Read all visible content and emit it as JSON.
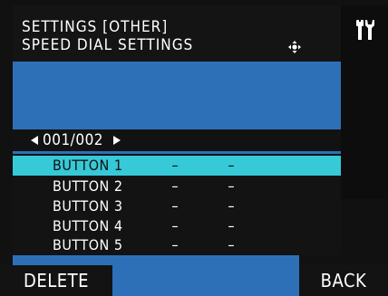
{
  "header": {
    "line1": "SETTINGS [OTHER]",
    "line2": "SPEED DIAL SETTINGS",
    "move_icon": "four-way-arrow-icon",
    "tools_icon": "wrench-screwdriver-icon"
  },
  "pager": {
    "text": "001/002"
  },
  "list": {
    "rows": [
      {
        "label": "BUTTON 1",
        "v1": "–",
        "v2": "–",
        "selected": true
      },
      {
        "label": "BUTTON 2",
        "v1": "–",
        "v2": "–",
        "selected": false
      },
      {
        "label": "BUTTON 3",
        "v1": "–",
        "v2": "–",
        "selected": false
      },
      {
        "label": "BUTTON 4",
        "v1": "–",
        "v2": "–",
        "selected": false
      },
      {
        "label": "BUTTON 5",
        "v1": "–",
        "v2": "–",
        "selected": false
      }
    ]
  },
  "buttons": {
    "delete": "DELETE",
    "back": "BACK"
  },
  "colors": {
    "panel_blue": "#2e70b8",
    "highlight": "#36c9d8"
  }
}
